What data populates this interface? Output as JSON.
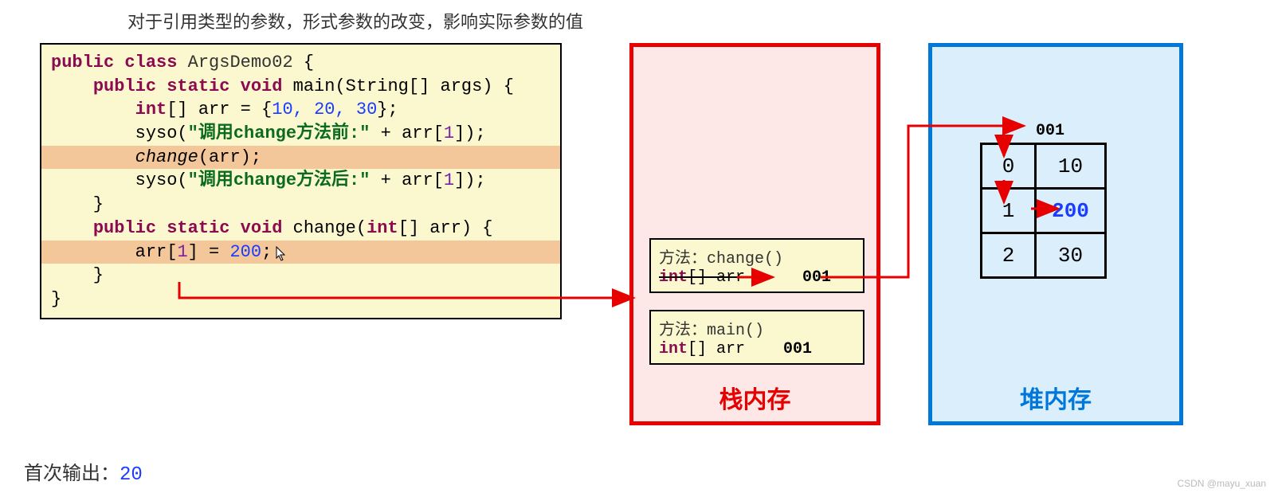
{
  "title": "对于引用类型的参数，形式参数的改变，影响实际参数的值",
  "code": {
    "class_name": "ArgsDemo02",
    "main_sig_1": "public static void",
    "main_sig_2": "main(String[] args) {",
    "arr_decl_1": "int",
    "arr_decl_2": "[] arr = {",
    "arr_vals": "10, 20, 30",
    "arr_decl_3": "};",
    "syso1_pre": "syso(",
    "syso1_str": "\"调用change方法前:\"",
    "syso1_post": " + arr[",
    "syso1_idx": "1",
    "syso1_end": "]);",
    "change_call": "change",
    "change_call_arg": "(arr);",
    "syso2_pre": "syso(",
    "syso2_str": "\"调用change方法后:\"",
    "syso2_post": " + arr[",
    "syso2_idx": "1",
    "syso2_end": "]);",
    "change_sig_1": "public static void",
    "change_sig_2": " change(",
    "change_sig_3": "int",
    "change_sig_4": "[] arr) {",
    "assign_1": "arr[",
    "assign_idx": "1",
    "assign_2": "] = ",
    "assign_val": "200",
    "assign_3": ";"
  },
  "stack": {
    "label": "栈内存",
    "frame_change": {
      "title": "方法：change()",
      "decl_type": "int",
      "decl_arr": "[] arr",
      "decl_val": "001"
    },
    "frame_main": {
      "title": "方法：main()",
      "decl_type": "int",
      "decl_arr": "[] arr",
      "decl_val": "001"
    }
  },
  "heap": {
    "label": "堆内存",
    "addr": "001",
    "table": [
      {
        "index": "0",
        "value": "10"
      },
      {
        "index": "1",
        "value": "200"
      },
      {
        "index": "2",
        "value": "30"
      }
    ]
  },
  "output": {
    "label": "首次输出：",
    "value": "20"
  },
  "watermark": "CSDN @mayu_xuan"
}
